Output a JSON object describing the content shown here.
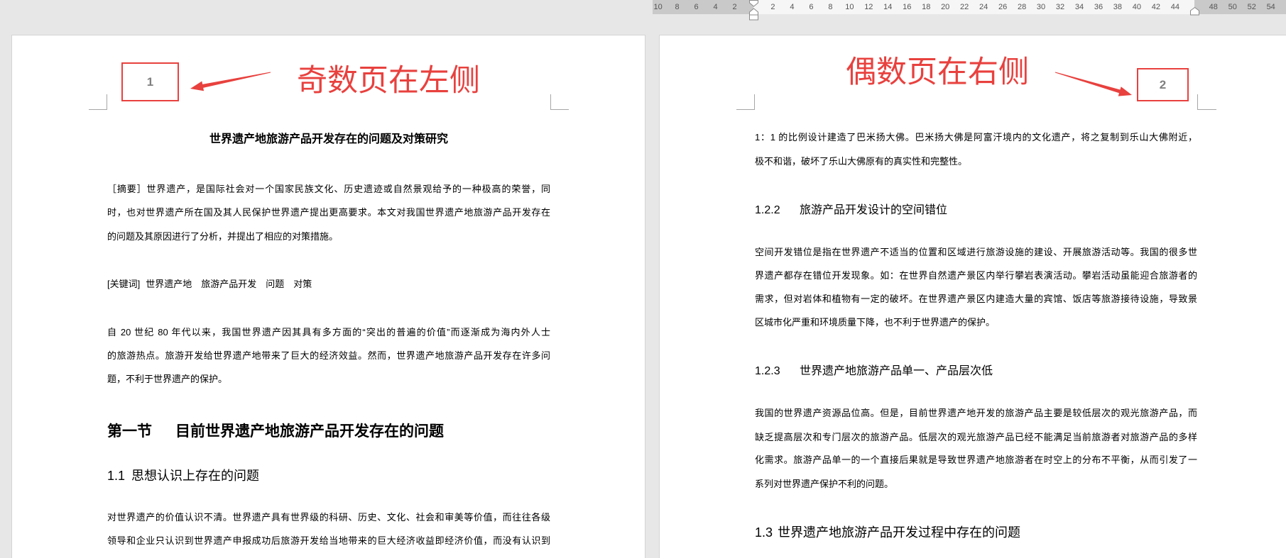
{
  "colors": {
    "annotation_red": "#e8413e",
    "page_number_gray": "#808080",
    "workspace_gray": "#e7e7e7"
  },
  "ruler": {
    "margin_left_ticks": [
      "10",
      "8",
      "6",
      "4",
      "2"
    ],
    "ticks": [
      "2",
      "4",
      "6",
      "8",
      "10",
      "12",
      "14",
      "16",
      "18",
      "20",
      "22",
      "24",
      "26",
      "28",
      "30",
      "32",
      "34",
      "36",
      "38",
      "40",
      "42",
      "44"
    ],
    "margin_right_ticks": [
      "48",
      "50",
      "52",
      "54"
    ]
  },
  "page_odd": {
    "page_number": "1",
    "annotation": "奇数页在左侧",
    "title": "世界遗产地旅游产品开发存在的问题及对策研究",
    "abstract": [
      "［摘要］世界遗产，是国际社会对一个国家民族文化、历史遗迹或自然景观给予的一种极高的荣誉，同",
      "时，也对世界遗产所在国及其人民保护世界遗产提出更高要求。本文对我国世界遗产地旅游产品开发存在",
      "的问题及其原因进行了分析，并提出了相应的对策措施。"
    ],
    "keywords": {
      "label": "[关键词]",
      "terms": [
        "世界遗产地",
        "旅游产品开发",
        "问题",
        "对策"
      ]
    },
    "intro": [
      "自 20 世纪 80 年代以来，我国世界遗产因其具有多方面的“突出的普遍的价值”而逐渐成为海内外人士",
      "的旅游热点。旅游开发给世界遗产地带来了巨大的经济效益。然而，世界遗产地旅游产品开发存在许多问",
      "题，不利于世界遗产的保护。"
    ],
    "section": {
      "number": "第一节",
      "text": "目前世界遗产地旅游产品开发存在的问题"
    },
    "subsection": {
      "number": "1.1",
      "text": "思想认识上存在的问题"
    },
    "body": [
      "对世界遗产的价值认识不清。世界遗产具有世界级的科研、历史、文化、社会和审美等价值，而往往各级",
      "领导和企业只认识到世界遗产申报成功后旅游开发给当地带来的巨大经济收益即经济价值，而没有认识到"
    ]
  },
  "page_even": {
    "page_number": "2",
    "annotation": "偶数页在右侧",
    "para_continued": [
      "1：1 的比例设计建造了巴米扬大佛。巴米扬大佛是阿富汗境内的文化遗产，将之复制到乐山大佛附近，",
      "极不和谐，破坏了乐山大佛原有的真实性和完整性。"
    ],
    "heading_a": {
      "number": "1.2.2",
      "text": "旅游产品开发设计的空间错位"
    },
    "para_a": [
      "空间开发错位是指在世界遗产不适当的位置和区域进行旅游设施的建设、开展旅游活动等。我国的很多世",
      "界遗产都存在错位开发现象。如：在世界自然遗产景区内举行攀岩表演活动。攀岩活动虽能迎合旅游者的",
      "需求，但对岩体和植物有一定的破坏。在世界遗产景区内建造大量的宾馆、饭店等旅游接待设施，导致景",
      "区城市化严重和环境质量下降，也不利于世界遗产的保护。"
    ],
    "heading_b": {
      "number": "1.2.3",
      "text": "世界遗产地旅游产品单一、产品层次低"
    },
    "para_b": [
      "我国的世界遗产资源品位高。但是，目前世界遗产地开发的旅游产品主要是较低层次的观光旅游产品，而",
      "缺乏提高层次和专门层次的旅游产品。低层次的观光旅游产品已经不能满足当前旅游者对旅游产品的多样",
      "化需求。旅游产品单一的一个直接后果就是导致世界遗产地旅游者在时空上的分布不平衡，从而引发了一",
      "系列对世界遗产保护不利的问题。"
    ],
    "heading_c": {
      "number": "1.3",
      "text": "世界遗产地旅游产品开发过程中存在的问题"
    }
  }
}
